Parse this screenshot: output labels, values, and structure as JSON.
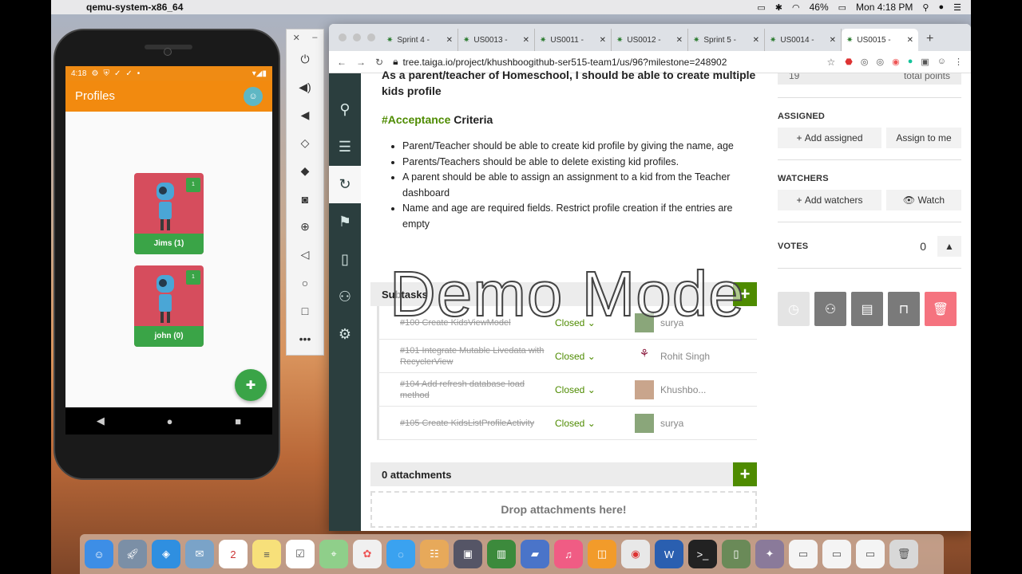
{
  "menubar": {
    "app_name": "qemu-system-x86_64",
    "battery": "46%",
    "clock": "Mon 4:18 PM"
  },
  "phone": {
    "status_time": "4:18",
    "app_title": "Profiles",
    "kids": [
      {
        "name": "Jims (1)",
        "badge": "1"
      },
      {
        "name": "john (0)",
        "badge": "1"
      }
    ]
  },
  "browser": {
    "tabs": [
      {
        "label": "Sprint 4 -"
      },
      {
        "label": "US0013 -"
      },
      {
        "label": "US0011 -"
      },
      {
        "label": "US0012 -"
      },
      {
        "label": "Sprint 5 -"
      },
      {
        "label": "US0014 -"
      },
      {
        "label": "US0015 -"
      }
    ],
    "url": "tree.taiga.io/project/khushboogithub-ser515-team1/us/96?milestone=248902"
  },
  "story": {
    "description_top": "As a parent/teacher of Homeschool, I should be able to create multiple kids profile",
    "acceptance_tag": "#Acceptance",
    "acceptance_rest": " Criteria",
    "criteria": [
      "Parent/Teacher should be able to create kid profile by giving the name, age",
      "Parents/Teachers should be able to delete existing kid profiles.",
      "A parent should be able to assign an assignment to a kid from the Teacher dashboard",
      "Name and age are required fields. Restrict profile creation if the entries  are empty"
    ],
    "subtasks_title": "Subtasks",
    "subtasks": [
      {
        "title": "#100 Create KidsViewModel",
        "status": "Closed",
        "assignee": "surya"
      },
      {
        "title": "#101 Integrate Mutable Livedata with RecyclerView",
        "status": "Closed",
        "assignee": "Rohit Singh"
      },
      {
        "title": "#104 Add refresh database load method",
        "status": "Closed",
        "assignee": "Khushbo..."
      },
      {
        "title": "#105 Create KidsListProfileActivity",
        "status": "Closed",
        "assignee": "surya"
      }
    ],
    "attachments_title": "0 attachments",
    "dropzone": "Drop attachments here!"
  },
  "sidebar": {
    "points_value": "19",
    "points_label": "total points",
    "assigned_title": "ASSIGNED",
    "add_assigned": "Add assigned",
    "assign_to_me": "Assign to me",
    "watchers_title": "WATCHERS",
    "add_watchers": "Add watchers",
    "watch": "Watch",
    "votes_title": "VOTES",
    "votes_count": "0"
  },
  "overlay": {
    "text": "Demo Mode"
  },
  "colors": {
    "taiga_green": "#4e8b00",
    "android_orange": "#f28a0f",
    "android_green": "#3aa447",
    "taiga_nav": "#2b3e3e",
    "delete_red": "#f5737f"
  }
}
